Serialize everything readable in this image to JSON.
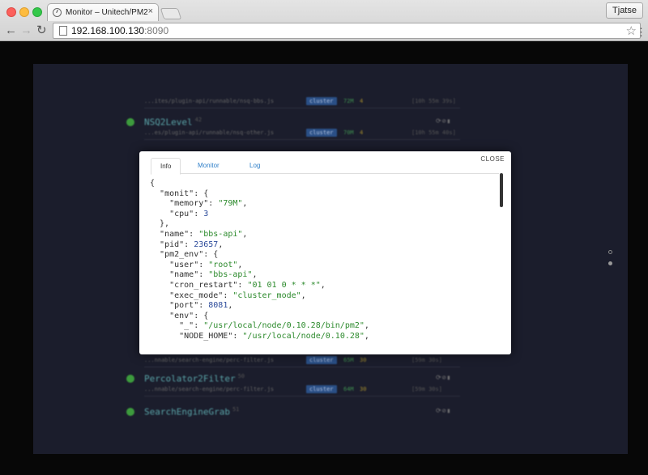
{
  "browser": {
    "tab_title": "Monitor – Unitech/PM2",
    "tab_close": "×",
    "profile": "Tjatse",
    "url_host": "192.168.100.130",
    "url_port": ":8090",
    "back": "←",
    "forward": "→",
    "reload": "↻",
    "star": "☆",
    "menu": "⋮"
  },
  "background_processes": [
    {
      "name": "",
      "id": "",
      "path": "...ites/plugin-api/runnable/nsq-bbs.js",
      "badge": "cluster",
      "mem": "72M",
      "cpu": "4",
      "uptime": "[10h 55m 39s]"
    },
    {
      "name": "NSQ2Level",
      "id": "42",
      "path": "...es/plugin-api/runnable/nsq-other.js",
      "badge": "cluster",
      "mem": "70M",
      "cpu": "4",
      "uptime": "[10h 55m 40s]"
    },
    {
      "name": "",
      "id": "",
      "path": "...nnable/search-engine/perc-filter.js",
      "badge": "cluster",
      "mem": "65M",
      "cpu": "30",
      "uptime": "[59m 30s]"
    },
    {
      "name": "Percolator2Filter",
      "id": "50",
      "path": "...nnable/search-engine/perc-filter.js",
      "badge": "cluster",
      "mem": "64M",
      "cpu": "30",
      "uptime": "[59m 30s]"
    },
    {
      "name": "SearchEngineGrab",
      "id": "51",
      "path": "",
      "badge": "",
      "mem": "",
      "cpu": "",
      "uptime": ""
    }
  ],
  "modal": {
    "close_label": "CLOSE",
    "tabs": [
      "Info",
      "Monitor",
      "Log"
    ],
    "active_tab": "Info",
    "json_lines": [
      [
        {
          "t": "p",
          "v": "{"
        }
      ],
      [
        {
          "t": "p",
          "v": "  "
        },
        {
          "t": "k",
          "v": "\"monit\""
        },
        {
          "t": "p",
          "v": ": {"
        }
      ],
      [
        {
          "t": "p",
          "v": "    "
        },
        {
          "t": "k",
          "v": "\"memory\""
        },
        {
          "t": "p",
          "v": ": "
        },
        {
          "t": "s",
          "v": "\"79M\""
        },
        {
          "t": "p",
          "v": ","
        }
      ],
      [
        {
          "t": "p",
          "v": "    "
        },
        {
          "t": "k",
          "v": "\"cpu\""
        },
        {
          "t": "p",
          "v": ": "
        },
        {
          "t": "n",
          "v": "3"
        }
      ],
      [
        {
          "t": "p",
          "v": "  },"
        }
      ],
      [
        {
          "t": "p",
          "v": "  "
        },
        {
          "t": "k",
          "v": "\"name\""
        },
        {
          "t": "p",
          "v": ": "
        },
        {
          "t": "s",
          "v": "\"bbs-api\""
        },
        {
          "t": "p",
          "v": ","
        }
      ],
      [
        {
          "t": "p",
          "v": "  "
        },
        {
          "t": "k",
          "v": "\"pid\""
        },
        {
          "t": "p",
          "v": ": "
        },
        {
          "t": "n",
          "v": "23657"
        },
        {
          "t": "p",
          "v": ","
        }
      ],
      [
        {
          "t": "p",
          "v": "  "
        },
        {
          "t": "k",
          "v": "\"pm2_env\""
        },
        {
          "t": "p",
          "v": ": {"
        }
      ],
      [
        {
          "t": "p",
          "v": "    "
        },
        {
          "t": "k",
          "v": "\"user\""
        },
        {
          "t": "p",
          "v": ": "
        },
        {
          "t": "s",
          "v": "\"root\""
        },
        {
          "t": "p",
          "v": ","
        }
      ],
      [
        {
          "t": "p",
          "v": "    "
        },
        {
          "t": "k",
          "v": "\"name\""
        },
        {
          "t": "p",
          "v": ": "
        },
        {
          "t": "s",
          "v": "\"bbs-api\""
        },
        {
          "t": "p",
          "v": ","
        }
      ],
      [
        {
          "t": "p",
          "v": "    "
        },
        {
          "t": "k",
          "v": "\"cron_restart\""
        },
        {
          "t": "p",
          "v": ": "
        },
        {
          "t": "s",
          "v": "\"01 01 0 * * *\""
        },
        {
          "t": "p",
          "v": ","
        }
      ],
      [
        {
          "t": "p",
          "v": "    "
        },
        {
          "t": "k",
          "v": "\"exec_mode\""
        },
        {
          "t": "p",
          "v": ": "
        },
        {
          "t": "s",
          "v": "\"cluster_mode\""
        },
        {
          "t": "p",
          "v": ","
        }
      ],
      [
        {
          "t": "p",
          "v": "    "
        },
        {
          "t": "k",
          "v": "\"port\""
        },
        {
          "t": "p",
          "v": ": "
        },
        {
          "t": "n",
          "v": "8081"
        },
        {
          "t": "p",
          "v": ","
        }
      ],
      [
        {
          "t": "p",
          "v": "    "
        },
        {
          "t": "k",
          "v": "\"env\""
        },
        {
          "t": "p",
          "v": ": {"
        }
      ],
      [
        {
          "t": "p",
          "v": "      "
        },
        {
          "t": "k",
          "v": "\"_\""
        },
        {
          "t": "p",
          "v": ": "
        },
        {
          "t": "s",
          "v": "\"/usr/local/node/0.10.28/bin/pm2\""
        },
        {
          "t": "p",
          "v": ","
        }
      ],
      [
        {
          "t": "p",
          "v": "      "
        },
        {
          "t": "k",
          "v": "\"NODE_HOME\""
        },
        {
          "t": "p",
          "v": ": "
        },
        {
          "t": "s",
          "v": "\"/usr/local/node/0.10.28\""
        },
        {
          "t": "p",
          "v": ","
        }
      ]
    ]
  },
  "colors": {
    "panel": "#1b1d2c",
    "json_string": "#2c8a2c",
    "json_number": "#2b4a9a",
    "tab_link": "#2f7fc8"
  }
}
